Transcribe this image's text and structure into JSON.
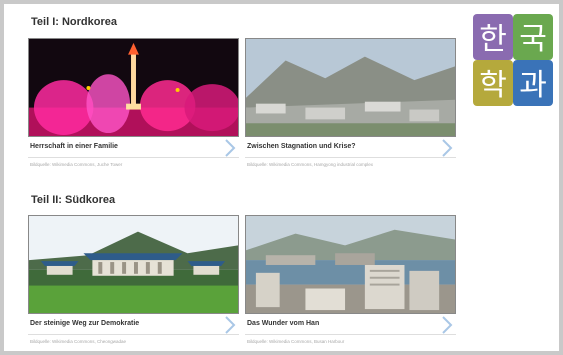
{
  "section1": {
    "title": "Teil I: Nordkorea"
  },
  "section2": {
    "title": "Teil II: Südkorea"
  },
  "cards": [
    {
      "caption": "Herrschaft in einer Familie",
      "credit": "Bildquelle: Wikimedia Commons, Juche Tower"
    },
    {
      "caption": "Zwischen Stagnation und Krise?",
      "credit": "Bildquelle: Wikimedia Commons, Hamgyong industrial complex"
    },
    {
      "caption": "Der steinige Weg zur Demokratie",
      "credit": "Bildquelle: Wikimedia Commons, Cheongwadae"
    },
    {
      "caption": "Das Wunder vom Han",
      "credit": "Bildquelle: Wikimedia Commons, Busan Harbour"
    }
  ],
  "logo": {
    "glyphs": [
      "한",
      "국",
      "학",
      "과"
    ],
    "colors": [
      "#8a6bb0",
      "#6aa84f",
      "#b5a93c",
      "#3a73b8"
    ]
  }
}
